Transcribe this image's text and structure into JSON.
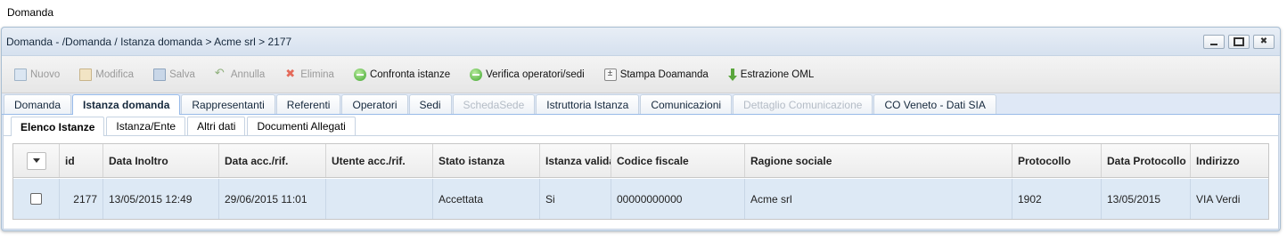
{
  "page": {
    "title": "Domanda"
  },
  "window": {
    "title": "Domanda - /Domanda / Istanza domanda > Acme srl > 2177",
    "controls": [
      "minimize-icon",
      "maximize-icon",
      "close-icon"
    ],
    "close_glyph": "✖"
  },
  "toolbar": {
    "buttons": [
      {
        "label": "Nuovo",
        "icon": "new-document-icon",
        "enabled": false
      },
      {
        "label": "Modifica",
        "icon": "edit-icon",
        "enabled": false
      },
      {
        "label": "Salva",
        "icon": "save-icon",
        "enabled": false
      },
      {
        "label": "Annulla",
        "icon": "undo-icon",
        "enabled": false
      },
      {
        "label": "Elimina",
        "icon": "delete-icon",
        "enabled": false
      },
      {
        "label": "Confronta istanze",
        "icon": "green-circle-icon",
        "enabled": true
      },
      {
        "label": "Verifica operatori/sedi",
        "icon": "green-circle-icon",
        "enabled": true
      },
      {
        "label": "Stampa Doamanda",
        "icon": "print-icon",
        "enabled": true
      },
      {
        "label": "Estrazione OML",
        "icon": "download-arrow-icon",
        "enabled": true
      }
    ]
  },
  "tabs": [
    {
      "label": "Domanda",
      "state": "normal"
    },
    {
      "label": "Istanza domanda",
      "state": "active"
    },
    {
      "label": "Rappresentanti",
      "state": "normal"
    },
    {
      "label": "Referenti",
      "state": "normal"
    },
    {
      "label": "Operatori",
      "state": "normal"
    },
    {
      "label": "Sedi",
      "state": "normal"
    },
    {
      "label": "SchedaSede",
      "state": "disabled"
    },
    {
      "label": "Istruttoria Istanza",
      "state": "normal"
    },
    {
      "label": "Comunicazioni",
      "state": "normal"
    },
    {
      "label": "Dettaglio Comunicazione",
      "state": "disabled"
    },
    {
      "label": "CO Veneto - Dati SIA",
      "state": "normal"
    }
  ],
  "subtabs": [
    {
      "label": "Elenco Istanze",
      "state": "active"
    },
    {
      "label": "Istanza/Ente",
      "state": "normal"
    },
    {
      "label": "Altri dati",
      "state": "normal"
    },
    {
      "label": "Documenti Allegati",
      "state": "normal"
    }
  ],
  "grid": {
    "columns": [
      "",
      "id",
      "Data Inoltro",
      "Data acc./rif.",
      "Utente acc./rif.",
      "Stato istanza",
      "Istanza valida",
      "Codice fiscale",
      "Ragione sociale",
      "Protocollo",
      "Data Protocollo",
      "Indirizzo"
    ],
    "rows": [
      {
        "checked": false,
        "cells": [
          "2177",
          "13/05/2015 12:49",
          "29/06/2015 11:01",
          "",
          "Accettata",
          "Si",
          "00000000000",
          "Acme srl",
          "1902",
          "13/05/2015",
          "VIA Verdi"
        ]
      }
    ]
  },
  "colors": {
    "panel_bg": "#dfe8f6",
    "selected_row": "#dde9f5",
    "tab_border": "#99bbe8",
    "disabled_text": "#9a9a9a"
  }
}
